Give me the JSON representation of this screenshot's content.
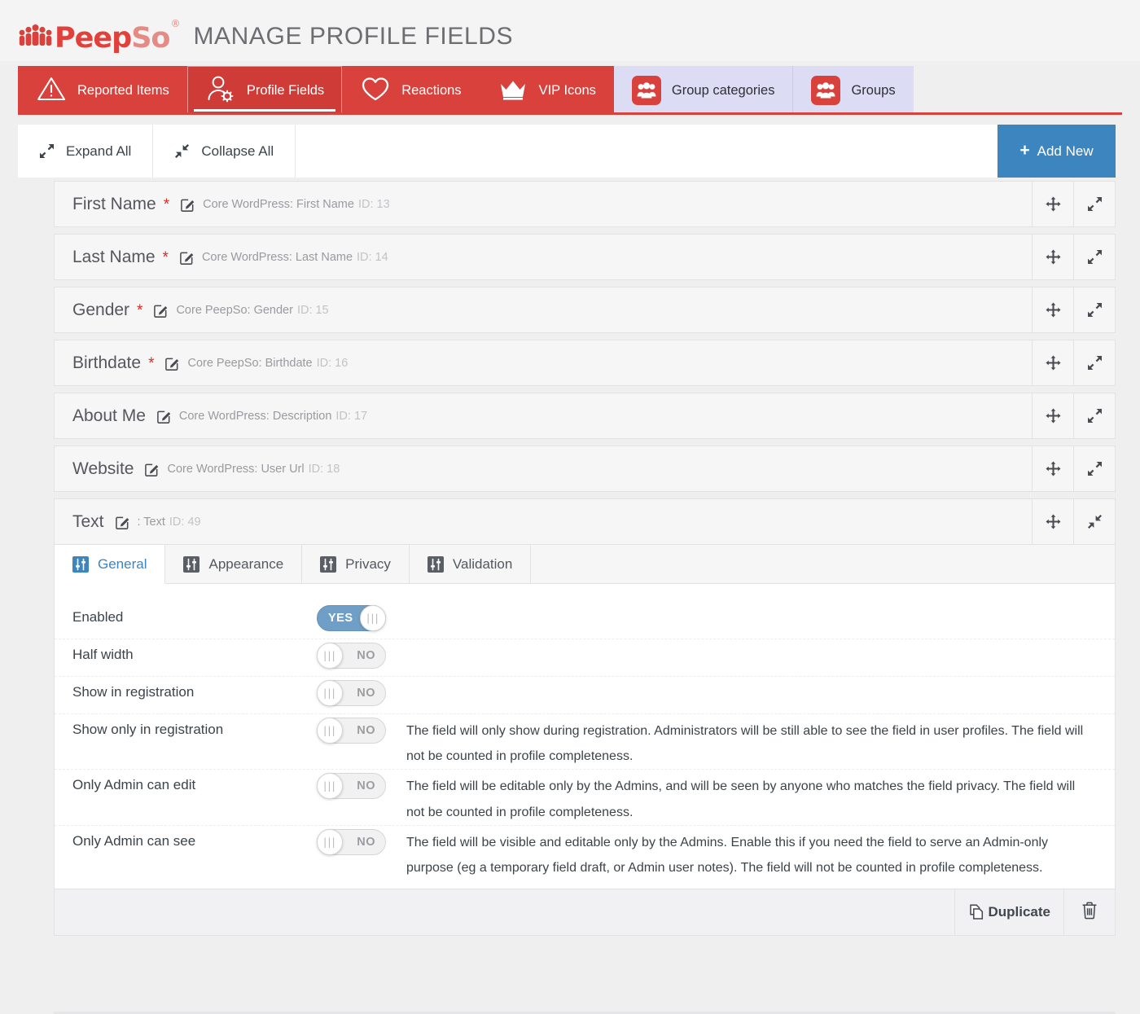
{
  "header": {
    "logo_peep": "Peep",
    "logo_so": "So",
    "logo_reg": "®",
    "title": "MANAGE PROFILE FIELDS"
  },
  "colors": {
    "brand_red": "#d9413c",
    "brand_red_active": "#cf3c38",
    "accent_blue": "#3c85bf",
    "toggle_on_blue": "#6f9ec6",
    "light_tab_bg": "#dcdcf5",
    "required_star": "#e02b23"
  },
  "tabbar": [
    {
      "label": "Reported Items",
      "icon": "warning-triangle-icon",
      "style": "red",
      "active": false
    },
    {
      "label": "Profile Fields",
      "icon": "user-gear-icon",
      "style": "red",
      "active": true
    },
    {
      "label": "Reactions",
      "icon": "heart-icon",
      "style": "red",
      "active": false
    },
    {
      "label": "VIP Icons",
      "icon": "crown-icon",
      "style": "red",
      "active": false
    },
    {
      "label": "Group categories",
      "icon": "group-people-icon",
      "style": "light",
      "active": false
    },
    {
      "label": "Groups",
      "icon": "group-people-icon",
      "style": "light",
      "active": false
    }
  ],
  "toolbar": {
    "expand_all": "Expand All",
    "collapse_all": "Collapse All",
    "add_new": "Add New",
    "add_new_plus": "+"
  },
  "fields": [
    {
      "title": "First Name",
      "required": true,
      "meta": "Core WordPress: First Name",
      "id_label": "ID: 13",
      "expanded": false
    },
    {
      "title": "Last Name",
      "required": true,
      "meta": "Core WordPress: Last Name",
      "id_label": "ID: 14",
      "expanded": false
    },
    {
      "title": "Gender",
      "required": true,
      "meta": "Core PeepSo: Gender",
      "id_label": "ID: 15",
      "expanded": false
    },
    {
      "title": "Birthdate",
      "required": true,
      "meta": "Core PeepSo: Birthdate",
      "id_label": "ID: 16",
      "expanded": false
    },
    {
      "title": "About Me",
      "required": false,
      "meta": "Core WordPress: Description",
      "id_label": "ID: 17",
      "expanded": false
    },
    {
      "title": "Website",
      "required": false,
      "meta": "Core WordPress: User Url",
      "id_label": "ID: 18",
      "expanded": false
    },
    {
      "title": "Text",
      "required": false,
      "meta": ": Text",
      "id_label": "ID: 49",
      "expanded": true
    }
  ],
  "panel": {
    "tabs": [
      {
        "label": "General",
        "icon": "sliders-icon",
        "active": true
      },
      {
        "label": "Appearance",
        "icon": "sliders-icon",
        "active": false
      },
      {
        "label": "Privacy",
        "icon": "sliders-icon",
        "active": false
      },
      {
        "label": "Validation",
        "icon": "sliders-icon",
        "active": false
      }
    ],
    "settings": [
      {
        "label": "Enabled",
        "value": "YES",
        "on": true,
        "description": ""
      },
      {
        "label": "Half width",
        "value": "NO",
        "on": false,
        "description": ""
      },
      {
        "label": "Show in registration",
        "value": "NO",
        "on": false,
        "description": ""
      },
      {
        "label": "Show only in registration",
        "value": "NO",
        "on": false,
        "description": "The field will only show during registration. Administrators will be still able to see the field in user profiles. The field will not be counted in profile completeness."
      },
      {
        "label": "Only Admin can edit",
        "value": "NO",
        "on": false,
        "description": "The field will be editable only by the Admins, and will be seen by anyone who matches the field privacy. The field will not be counted in profile completeness."
      },
      {
        "label": "Only Admin can see",
        "value": "NO",
        "on": false,
        "description": "The field will be visible and editable only by the Admins. Enable this if you need the field to serve an Admin-only purpose (eg a temporary field draft, or Admin user notes). The field will not be counted in profile completeness."
      }
    ],
    "footer": {
      "duplicate": "Duplicate",
      "delete_icon": "trash-icon"
    }
  },
  "row_actions": {
    "move": "move-icon",
    "expand": "expand-arrows-icon",
    "collapse": "collapse-arrows-icon"
  },
  "toggle_knob_glyph": "|||"
}
